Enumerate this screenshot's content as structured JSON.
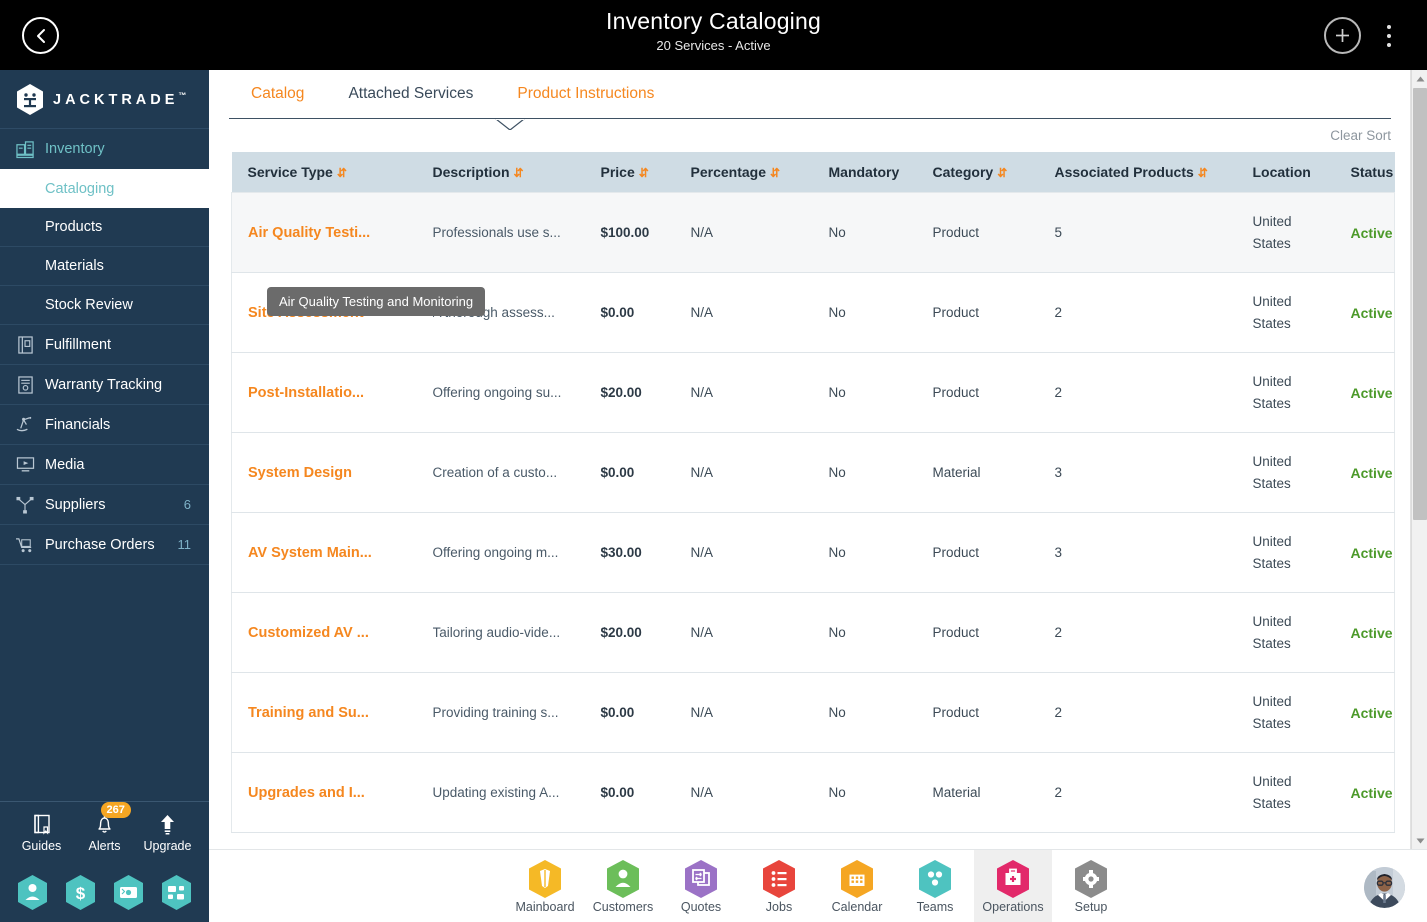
{
  "topbar": {
    "back_icon": "chevron-left-icon",
    "title": "Inventory Cataloging",
    "subtitle": "20 Services - Active",
    "add_icon": "plus-icon",
    "menu_icon": "kebab-menu-icon"
  },
  "sidebar": {
    "brand": "JACKTRADE",
    "brand_tm": "™",
    "items": [
      {
        "label": "Inventory",
        "icon": "inventory-icon",
        "badge": "",
        "type": "parent",
        "active": true
      },
      {
        "label": "Cataloging",
        "icon": "",
        "badge": "",
        "type": "sub",
        "selected": true
      },
      {
        "label": "Products",
        "icon": "",
        "badge": "",
        "type": "sub",
        "selected": false
      },
      {
        "label": "Materials",
        "icon": "",
        "badge": "",
        "type": "sub",
        "selected": false
      },
      {
        "label": "Stock Review",
        "icon": "",
        "badge": "",
        "type": "sub",
        "selected": false
      },
      {
        "label": "Fulfillment",
        "icon": "fulfillment-icon",
        "badge": "",
        "type": "top",
        "active": false
      },
      {
        "label": "Warranty Tracking",
        "icon": "warranty-icon",
        "badge": "",
        "type": "top",
        "active": false
      },
      {
        "label": "Financials",
        "icon": "financials-icon",
        "badge": "",
        "type": "top",
        "active": false
      },
      {
        "label": "Media",
        "icon": "media-icon",
        "badge": "",
        "type": "top",
        "active": false
      },
      {
        "label": "Suppliers",
        "icon": "suppliers-icon",
        "badge": "6",
        "type": "top",
        "active": false
      },
      {
        "label": "Purchase Orders",
        "icon": "purchase-orders-icon",
        "badge": "11",
        "type": "top",
        "active": false
      }
    ],
    "bottom_tools": [
      {
        "label": "Guides",
        "icon": "book-icon",
        "badge": ""
      },
      {
        "label": "Alerts",
        "icon": "bell-icon",
        "badge": "267"
      },
      {
        "label": "Upgrade",
        "icon": "up-arrow-icon",
        "badge": ""
      }
    ],
    "hex_shortcuts": [
      {
        "icon": "person-hex-icon"
      },
      {
        "icon": "dollar-hex-icon"
      },
      {
        "icon": "payment-hex-icon"
      },
      {
        "icon": "workflow-hex-icon"
      }
    ]
  },
  "main": {
    "tabs": [
      {
        "label": "Catalog",
        "active": false
      },
      {
        "label": "Attached Services",
        "active": true
      },
      {
        "label": "Product Instructions",
        "active": false
      }
    ],
    "clear_sort": "Clear Sort",
    "tooltip": "Air Quality Testing and Monitoring",
    "table": {
      "columns": [
        {
          "label": "Service Type",
          "sortable": true
        },
        {
          "label": "Description",
          "sortable": true
        },
        {
          "label": "Price",
          "sortable": true
        },
        {
          "label": "Percentage",
          "sortable": true
        },
        {
          "label": "Mandatory",
          "sortable": false
        },
        {
          "label": "Category",
          "sortable": true
        },
        {
          "label": "Associated Products",
          "sortable": true
        },
        {
          "label": "Location",
          "sortable": false
        },
        {
          "label": "Status",
          "sortable": false
        }
      ],
      "rows": [
        {
          "service_type": "Air Quality Testi...",
          "description": "Professionals use s...",
          "price": "$100.00",
          "percentage": "N/A",
          "mandatory": "No",
          "category": "Product",
          "associated_products": "5",
          "location": "United States",
          "status": "Active"
        },
        {
          "service_type": "Site Assessment",
          "description": "A thorough assess...",
          "price": "$0.00",
          "percentage": "N/A",
          "mandatory": "No",
          "category": "Product",
          "associated_products": "2",
          "location": "United States",
          "status": "Active"
        },
        {
          "service_type": "Post-Installatio...",
          "description": "Offering ongoing su...",
          "price": "$20.00",
          "percentage": "N/A",
          "mandatory": "No",
          "category": "Product",
          "associated_products": "2",
          "location": "United States",
          "status": "Active"
        },
        {
          "service_type": "System Design",
          "description": "Creation of a custo...",
          "price": "$0.00",
          "percentage": "N/A",
          "mandatory": "No",
          "category": "Material",
          "associated_products": "3",
          "location": "United States",
          "status": "Active"
        },
        {
          "service_type": "AV System Main...",
          "description": "Offering ongoing m...",
          "price": "$30.00",
          "percentage": "N/A",
          "mandatory": "No",
          "category": "Product",
          "associated_products": "3",
          "location": "United States",
          "status": "Active"
        },
        {
          "service_type": "Customized AV ...",
          "description": "Tailoring audio-vide...",
          "price": "$20.00",
          "percentage": "N/A",
          "mandatory": "No",
          "category": "Product",
          "associated_products": "2",
          "location": "United States",
          "status": "Active"
        },
        {
          "service_type": "Training and Su...",
          "description": "Providing training s...",
          "price": "$0.00",
          "percentage": "N/A",
          "mandatory": "No",
          "category": "Product",
          "associated_products": "2",
          "location": "United States",
          "status": "Active"
        },
        {
          "service_type": "Upgrades and I...",
          "description": "Updating existing A...",
          "price": "$0.00",
          "percentage": "N/A",
          "mandatory": "No",
          "category": "Material",
          "associated_products": "2",
          "location": "United States",
          "status": "Active"
        }
      ]
    }
  },
  "bottombar": {
    "items": [
      {
        "label": "Mainboard",
        "icon": "mainboard-icon",
        "color": "#f5b926",
        "selected": false
      },
      {
        "label": "Customers",
        "icon": "customers-icon",
        "color": "#6cbe5a",
        "selected": false
      },
      {
        "label": "Quotes",
        "icon": "quotes-icon",
        "color": "#9b72c6",
        "selected": false
      },
      {
        "label": "Jobs",
        "icon": "jobs-icon",
        "color": "#e8453c",
        "selected": false
      },
      {
        "label": "Calendar",
        "icon": "calendar-icon",
        "color": "#f5a623",
        "selected": false
      },
      {
        "label": "Teams",
        "icon": "teams-icon",
        "color": "#4ec3c0",
        "selected": false
      },
      {
        "label": "Operations",
        "icon": "operations-icon",
        "color": "#e2296a",
        "selected": true
      },
      {
        "label": "Setup",
        "icon": "setup-icon",
        "color": "#8b8b8b",
        "selected": false
      }
    ],
    "avatar": "user-avatar"
  },
  "colors": {
    "accent_orange": "#f5871f",
    "sidebar_bg": "#203a52",
    "teal": "#6fc1c6",
    "status_green": "#4c9a2a",
    "header_bg": "#cfdce4"
  },
  "scrollbar": {
    "up_icon": "scroll-up-icon",
    "down_icon": "scroll-down-icon"
  }
}
